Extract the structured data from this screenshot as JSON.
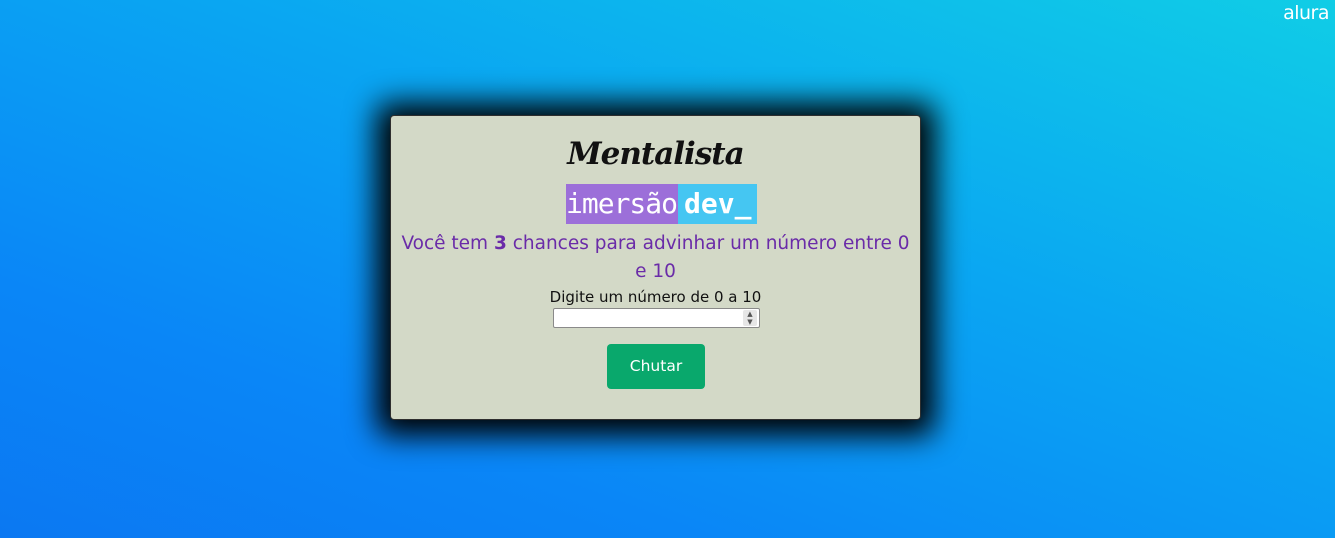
{
  "brand": {
    "label": "alura"
  },
  "card": {
    "title": "Mentalista",
    "logo": {
      "left": "imersão",
      "right": "dev_"
    },
    "message": {
      "prefix": "Você tem ",
      "chances": "3",
      "suffix": " chances para advinhar um número entre 0 e 10"
    },
    "input": {
      "label": "Digite um número de 0 a 10",
      "value": ""
    },
    "button": {
      "label": "Chutar"
    }
  },
  "colors": {
    "background_start": "#10cde6",
    "background_end": "#0b78f2",
    "card_bg": "#d3d9c7",
    "message_text": "#6a2ba8",
    "button_bg": "#09a86c",
    "logo_left_bg": "#9c6fd9",
    "logo_right_bg": "#45c6f2"
  }
}
